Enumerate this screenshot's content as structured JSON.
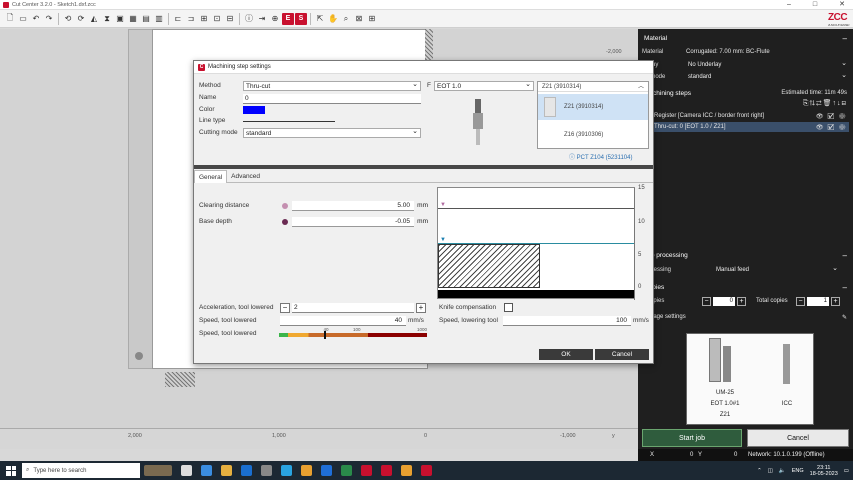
{
  "window": {
    "title": "Cut Center 3.2.0 - Sketch1.dxf.zcc"
  },
  "canvas": {
    "ruler_bottom": [
      "2,000",
      "1,000",
      "0",
      "-1,000"
    ],
    "ruler_axis_label": "y",
    "ruler_right": "-2,000"
  },
  "dialog": {
    "title": "Machining step settings",
    "method_label": "Method",
    "method_value": "Thru-cut",
    "tool_value": "EOT 1.0",
    "tool_prefix": "F",
    "name_label": "Name",
    "name_value": "0",
    "color_label": "Color",
    "line_type_label": "Line type",
    "cutting_mode_label": "Cutting mode",
    "cutting_mode_value": "standard",
    "tool_list": {
      "header": "Z21 (3910314)",
      "items": [
        {
          "label": "Z21 (3910314)",
          "active": true
        },
        {
          "label": "Z16 (3910306)",
          "active": false
        }
      ]
    },
    "pct_label": "PCT Z104 (5231104)",
    "tabs": [
      "General",
      "Advanced"
    ],
    "clearing_distance_label": "Clearing distance",
    "clearing_distance_value": "5.00",
    "base_depth_label": "Base depth",
    "base_depth_value": "-0.05",
    "unit_mm": "mm",
    "unit_mms": "mm/s",
    "graph_ticks": [
      "15",
      "10",
      "5",
      "0"
    ],
    "acceleration_label": "Acceleration, tool lowered",
    "acceleration_value": "2",
    "knife_comp_label": "Knife compensation",
    "speed_lowered_label": "Speed, tool lowered",
    "speed_lowered_value": "40",
    "speed_lowering_label": "Speed, lowering tool",
    "speed_lowering_value": "100",
    "speed_gauge_label": "Speed, tool lowered",
    "gauge_marks": [
      "40",
      "100",
      "1000"
    ],
    "gauge_level_mms": 40,
    "ok_label": "OK",
    "cancel_label": "Cancel"
  },
  "right_panel": {
    "material_header": "Material",
    "material_label": "Material",
    "material_value": "Corrugated: 7.00 mm: BC-Flute",
    "underlay_label": "derlay",
    "underlay_value": "No Underlay",
    "mode_label": "ng mode",
    "mode_value": "standard",
    "machining_header": "Machining steps",
    "estimated": "Estimated time: 11m 49s",
    "steps": [
      {
        "label": "Register [Camera ICC / border front right]",
        "selected": false
      },
      {
        "label": "Thru-cut: 0 [EOT 1.0 / Z21]",
        "selected": true
      }
    ],
    "job_processing_header": "Job processing",
    "processing_label": "processing",
    "processing_value": "Manual feed",
    "copies_header": "Copies",
    "copies_label": "e copies",
    "copies_value": "0",
    "total_copies_label": "Total copies",
    "total_copies_value": "1",
    "page_settings_label": "y / page settings",
    "toolbox": {
      "module": "UM-25",
      "tool": "EOT 1.0#1",
      "insert": "Z21",
      "camera": "ICC"
    },
    "start_job": "Start job",
    "cancel": "Cancel"
  },
  "status": {
    "x_label": "X",
    "x_value": "0",
    "y_label": "Y",
    "y_value": "0",
    "network": "Network: 10.1.0.199 (Offline)"
  },
  "taskbar": {
    "search_placeholder": "Type here to search",
    "lang": "ENG",
    "time": "23:11",
    "date": "18-05-2023"
  },
  "colors": {
    "accent_red": "#c8102e",
    "line_color": "#0000ff",
    "start_job_green": "#2f5c3d"
  }
}
